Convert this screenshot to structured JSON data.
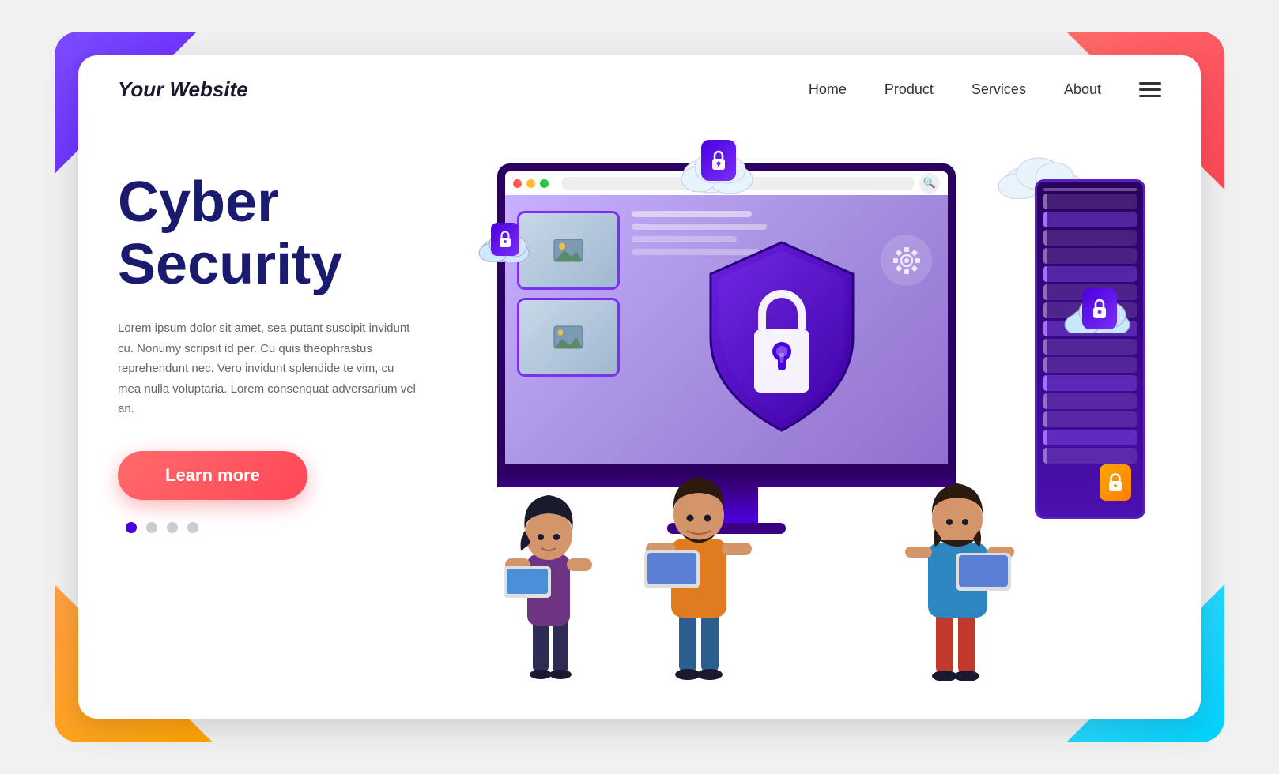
{
  "brand": {
    "name": "Your Website"
  },
  "navbar": {
    "home": "Home",
    "product": "Product",
    "services": "Services",
    "about": "About"
  },
  "hero": {
    "title_line1": "Cyber",
    "title_line2": "Security",
    "description": "Lorem ipsum dolor sit amet, sea putant suscipit invidunt cu. Nonumy scripsit id per. Cu quis theophrastus reprehendunt nec. Vero invidunt splendide te vim, cu mea nulla voluptaria. Lorem consenquat adversarium vel an.",
    "cta_label": "Learn more"
  },
  "dots": {
    "active_color": "#4a00e0",
    "inactive_color": "#cccccc"
  },
  "colors": {
    "accent_purple": "#4a00e0",
    "accent_red": "#ff4757",
    "accent_orange": "#ffa502",
    "accent_blue": "#00d2ff",
    "title_color": "#1a1a6e",
    "corner_tl": "#7c4dff",
    "corner_tr": "#ff6b6b",
    "corner_bl": "#ff9f43",
    "corner_br": "#48dbfb"
  }
}
